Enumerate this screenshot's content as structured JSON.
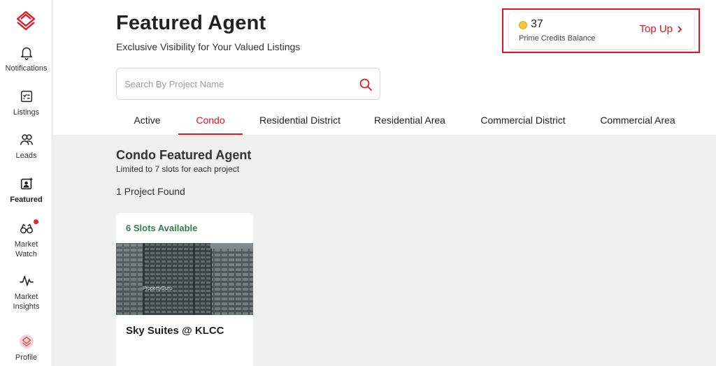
{
  "sidebar": {
    "items": [
      {
        "label": "Notifications",
        "icon": "bell-icon"
      },
      {
        "label": "Listings",
        "icon": "listings-icon"
      },
      {
        "label": "Leads",
        "icon": "users-icon"
      },
      {
        "label": "Featured",
        "icon": "featured-icon",
        "active": true
      },
      {
        "label": "Market\nWatch",
        "line1": "Market",
        "line2": "Watch",
        "icon": "binoculars-icon",
        "has_notification": true
      },
      {
        "label": "Market\nInsights",
        "line1": "Market",
        "line2": "Insights",
        "icon": "pulse-icon"
      },
      {
        "label": "Profile",
        "icon": "profile-avatar-icon"
      }
    ]
  },
  "header": {
    "title": "Featured Agent",
    "subtitle": "Exclusive Visibility for Your Valued Listings"
  },
  "credits": {
    "value": "37",
    "label": "Prime Credits Balance",
    "topup_label": "Top Up"
  },
  "search": {
    "placeholder": "Search By Project Name",
    "value": ""
  },
  "tabs": [
    {
      "label": "Active"
    },
    {
      "label": "Condo",
      "active": true
    },
    {
      "label": "Residential District"
    },
    {
      "label": "Residential Area"
    },
    {
      "label": "Commercial District"
    },
    {
      "label": "Commercial Area"
    }
  ],
  "content": {
    "section_title": "Condo Featured Agent",
    "section_sub": "Limited to 7 slots for each project",
    "found": "1 Project Found",
    "projects": [
      {
        "slots": "6 Slots Available",
        "name": "Sky Suites @ KLCC",
        "watermark": "PropertyGuru"
      }
    ]
  },
  "colors": {
    "accent": "#e0151f",
    "slots_green": "#2e7d4f",
    "content_bg": "#efefef"
  }
}
